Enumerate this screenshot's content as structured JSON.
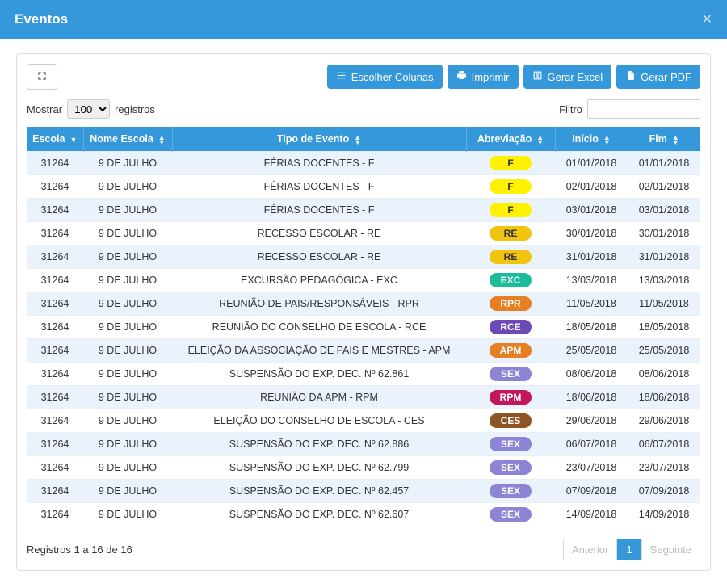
{
  "modal": {
    "title": "Eventos"
  },
  "toolbar": {
    "columns_label": "Escolher Colunas",
    "print_label": "Imprimir",
    "excel_label": "Gerar Excel",
    "pdf_label": "Gerar PDF"
  },
  "controls": {
    "show_label": "Mostrar",
    "page_size": "100",
    "records_label": "registros",
    "filter_label": "Filtro",
    "filter_value": ""
  },
  "columns": [
    {
      "label": "Escola",
      "sort": "desc"
    },
    {
      "label": "Nome Escola",
      "sort": "both"
    },
    {
      "label": "Tipo de Evento",
      "sort": "both"
    },
    {
      "label": "Abreviação",
      "sort": "both"
    },
    {
      "label": "Início",
      "sort": "both"
    },
    {
      "label": "Fim",
      "sort": "both"
    }
  ],
  "badge_colors": {
    "F": {
      "bg": "#fff200",
      "fg": "#333333"
    },
    "RE": {
      "bg": "#f1c40f",
      "fg": "#333333"
    },
    "EXC": {
      "bg": "#1abc9c",
      "fg": "#ffffff"
    },
    "RPR": {
      "bg": "#e67e22",
      "fg": "#ffffff"
    },
    "RCE": {
      "bg": "#6c4ab6",
      "fg": "#ffffff"
    },
    "APM": {
      "bg": "#e67e22",
      "fg": "#ffffff"
    },
    "SEX": {
      "bg": "#8e84d6",
      "fg": "#ffffff"
    },
    "RPM": {
      "bg": "#c2185b",
      "fg": "#ffffff"
    },
    "CES": {
      "bg": "#8d5524",
      "fg": "#ffffff"
    }
  },
  "rows": [
    {
      "escola": "31264",
      "nome": "9 DE JULHO",
      "tipo": "FÉRIAS DOCENTES - F",
      "abrev": "F",
      "inicio": "01/01/2018",
      "fim": "01/01/2018"
    },
    {
      "escola": "31264",
      "nome": "9 DE JULHO",
      "tipo": "FÉRIAS DOCENTES - F",
      "abrev": "F",
      "inicio": "02/01/2018",
      "fim": "02/01/2018"
    },
    {
      "escola": "31264",
      "nome": "9 DE JULHO",
      "tipo": "FÉRIAS DOCENTES - F",
      "abrev": "F",
      "inicio": "03/01/2018",
      "fim": "03/01/2018"
    },
    {
      "escola": "31264",
      "nome": "9 DE JULHO",
      "tipo": "RECESSO ESCOLAR - RE",
      "abrev": "RE",
      "inicio": "30/01/2018",
      "fim": "30/01/2018"
    },
    {
      "escola": "31264",
      "nome": "9 DE JULHO",
      "tipo": "RECESSO ESCOLAR - RE",
      "abrev": "RE",
      "inicio": "31/01/2018",
      "fim": "31/01/2018"
    },
    {
      "escola": "31264",
      "nome": "9 DE JULHO",
      "tipo": "EXCURSÃO PEDAGÓGICA - EXC",
      "abrev": "EXC",
      "inicio": "13/03/2018",
      "fim": "13/03/2018"
    },
    {
      "escola": "31264",
      "nome": "9 DE JULHO",
      "tipo": "REUNIÃO DE PAIS/RESPONSÁVEIS - RPR",
      "abrev": "RPR",
      "inicio": "11/05/2018",
      "fim": "11/05/2018"
    },
    {
      "escola": "31264",
      "nome": "9 DE JULHO",
      "tipo": "REUNIÃO DO CONSELHO DE ESCOLA - RCE",
      "abrev": "RCE",
      "inicio": "18/05/2018",
      "fim": "18/05/2018"
    },
    {
      "escola": "31264",
      "nome": "9 DE JULHO",
      "tipo": "ELEIÇÃO DA ASSOCIAÇÃO DE PAIS E MESTRES - APM",
      "abrev": "APM",
      "inicio": "25/05/2018",
      "fim": "25/05/2018"
    },
    {
      "escola": "31264",
      "nome": "9 DE JULHO",
      "tipo": "SUSPENSÃO DO EXP. DEC. Nº 62.861",
      "abrev": "SEX",
      "inicio": "08/06/2018",
      "fim": "08/06/2018"
    },
    {
      "escola": "31264",
      "nome": "9 DE JULHO",
      "tipo": "REUNIÃO DA APM - RPM",
      "abrev": "RPM",
      "inicio": "18/06/2018",
      "fim": "18/06/2018"
    },
    {
      "escola": "31264",
      "nome": "9 DE JULHO",
      "tipo": "ELEIÇÃO DO CONSELHO DE ESCOLA - CES",
      "abrev": "CES",
      "inicio": "29/06/2018",
      "fim": "29/06/2018"
    },
    {
      "escola": "31264",
      "nome": "9 DE JULHO",
      "tipo": "SUSPENSÃO DO EXP. DEC. Nº 62.886",
      "abrev": "SEX",
      "inicio": "06/07/2018",
      "fim": "06/07/2018"
    },
    {
      "escola": "31264",
      "nome": "9 DE JULHO",
      "tipo": "SUSPENSÃO DO EXP. DEC. Nº 62.799",
      "abrev": "SEX",
      "inicio": "23/07/2018",
      "fim": "23/07/2018"
    },
    {
      "escola": "31264",
      "nome": "9 DE JULHO",
      "tipo": "SUSPENSÃO DO EXP. DEC. Nº 62.457",
      "abrev": "SEX",
      "inicio": "07/09/2018",
      "fim": "07/09/2018"
    },
    {
      "escola": "31264",
      "nome": "9 DE JULHO",
      "tipo": "SUSPENSÃO DO EXP. DEC. Nº 62.607",
      "abrev": "SEX",
      "inicio": "14/09/2018",
      "fim": "14/09/2018"
    }
  ],
  "footer": {
    "info": "Registros 1 a 16 de 16",
    "prev": "Anterior",
    "page": "1",
    "next": "Seguinte"
  }
}
